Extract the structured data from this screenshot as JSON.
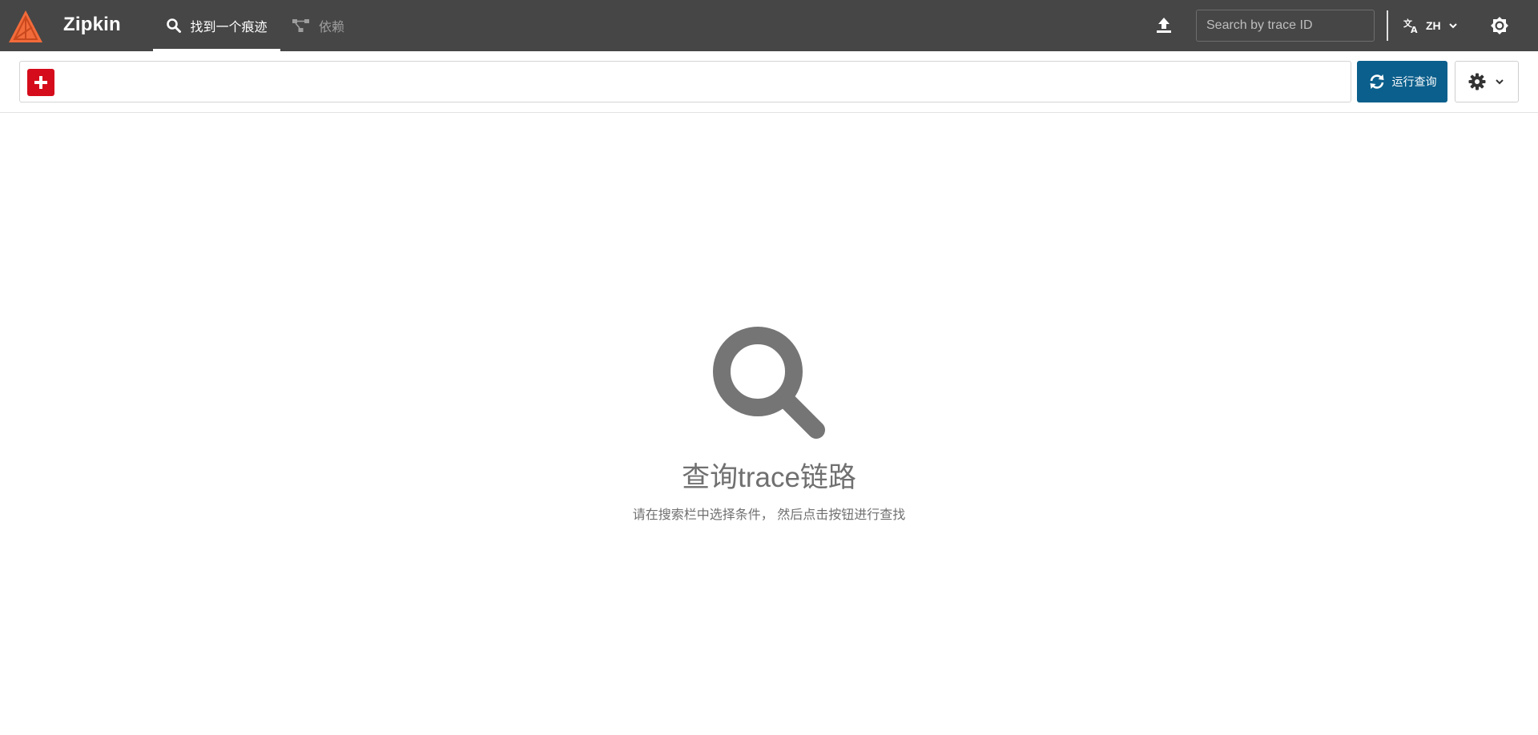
{
  "header": {
    "brand": "Zipkin",
    "tabs": [
      {
        "label": "找到一个痕迹",
        "icon": "search-icon",
        "active": true
      },
      {
        "label": "依赖",
        "icon": "dependency-graph-icon",
        "active": false
      }
    ],
    "trace_search": {
      "placeholder": "Search by trace ID",
      "value": ""
    },
    "language": "ZH",
    "colors": {
      "background": "#464646",
      "logo": "#f26b3a"
    }
  },
  "search_bar": {
    "add_button_icon": "plus-icon",
    "run_query_label": "运行查询",
    "colors": {
      "add": "#d50c1b",
      "run": "#0b5f8c"
    }
  },
  "empty_state": {
    "icon": "magnifier-icon",
    "title": "查询trace链路",
    "subtitle": "请在搜索栏中选择条件， 然后点击按钮进行查找"
  }
}
